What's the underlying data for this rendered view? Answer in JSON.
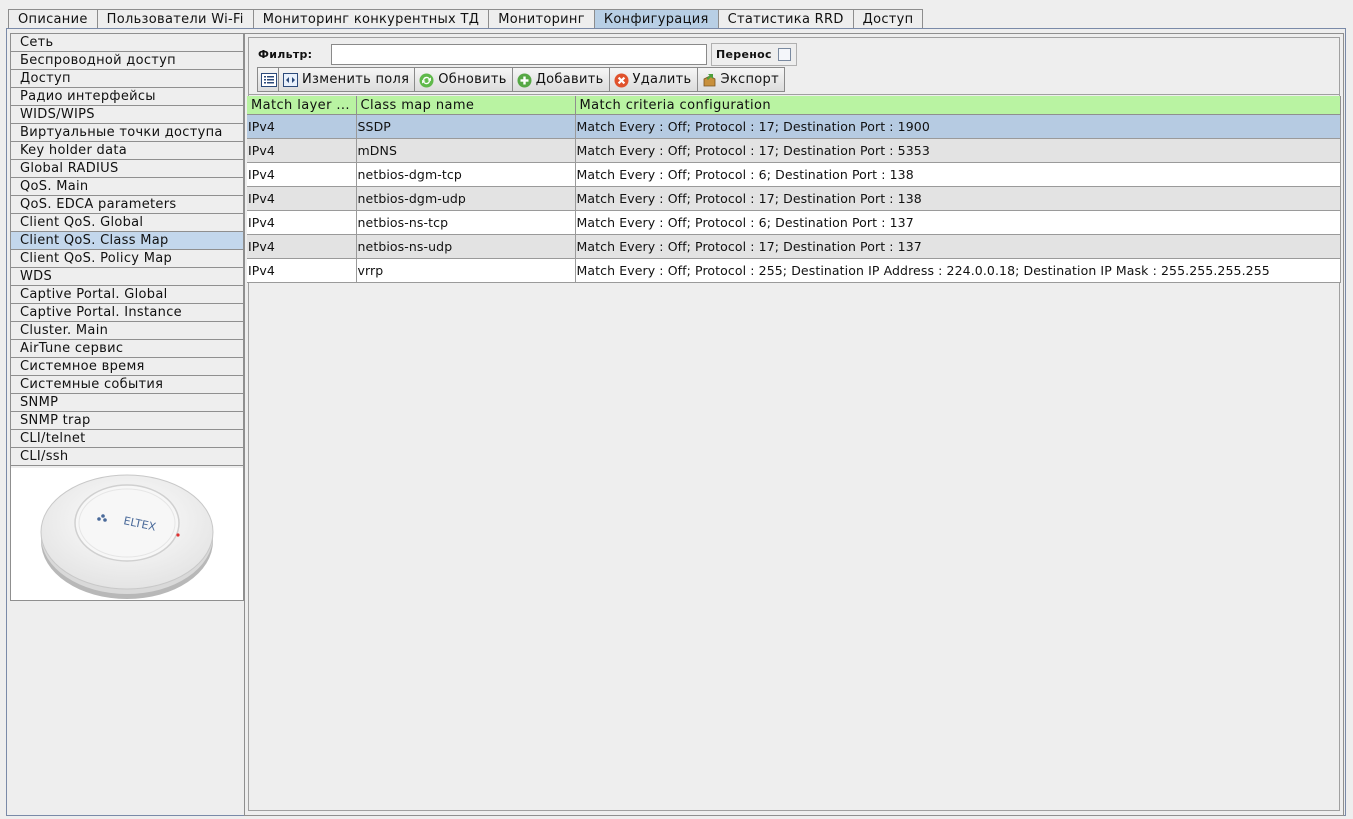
{
  "tabs": [
    {
      "label": "Описание",
      "active": false
    },
    {
      "label": "Пользователи Wi-Fi",
      "active": false
    },
    {
      "label": "Мониторинг конкурентных ТД",
      "active": false
    },
    {
      "label": "Мониторинг",
      "active": false
    },
    {
      "label": "Конфигурация",
      "active": true
    },
    {
      "label": "Статистика RRD",
      "active": false
    },
    {
      "label": "Доступ",
      "active": false
    }
  ],
  "sidebar": {
    "items": [
      "Сеть",
      "Беспроводной доступ",
      "Доступ",
      "Радио интерфейсы",
      "WIDS/WIPS",
      "Виртуальные точки доступа",
      "Key holder data",
      "Global RADIUS",
      "QoS. Main",
      "QoS. EDCA parameters",
      "Client QoS. Global",
      "Client QoS. Class Map",
      "Client QoS. Policy Map",
      "WDS",
      "Captive Portal. Global",
      "Captive Portal. Instance",
      "Cluster. Main",
      "AirTune сервис",
      "Системное время",
      "Системные события",
      "SNMP",
      "SNMP trap",
      "CLI/telnet",
      "CLI/ssh"
    ],
    "active_index": 11,
    "device_logo": "ELTEX"
  },
  "filter": {
    "label": "Фильтр:",
    "value": "",
    "wrap_label": "Перенос",
    "wrap_checked": false
  },
  "toolbar": {
    "list_icon": "list-icon",
    "edit_fields": "Изменить поля",
    "refresh": "Обновить",
    "add": "Добавить",
    "delete": "Удалить",
    "export": "Экспорт"
  },
  "table": {
    "columns": [
      "Match layer ...",
      "Class map name",
      "Match criteria configuration"
    ],
    "rows": [
      [
        "IPv4",
        "SSDP",
        "Match Every : Off; Protocol : 17; Destination Port : 1900"
      ],
      [
        "IPv4",
        "mDNS",
        "Match Every : Off; Protocol : 17; Destination Port : 5353"
      ],
      [
        "IPv4",
        "netbios-dgm-tcp",
        "Match Every : Off; Protocol : 6; Destination Port : 138"
      ],
      [
        "IPv4",
        "netbios-dgm-udp",
        "Match Every : Off; Protocol : 17; Destination Port : 138"
      ],
      [
        "IPv4",
        "netbios-ns-tcp",
        "Match Every : Off; Protocol : 6; Destination Port : 137"
      ],
      [
        "IPv4",
        "netbios-ns-udp",
        "Match Every : Off; Protocol : 17; Destination Port : 137"
      ],
      [
        "IPv4",
        "vrrp",
        "Match Every : Off; Protocol : 255; Destination IP Address : 224.0.0.18; Destination IP Mask : 255.255.255.255"
      ]
    ],
    "selected_row": 0
  },
  "colors": {
    "header_green": "#b9f3a2",
    "selection_blue": "#b6cbe2",
    "tab_active": "#b8cfe5"
  }
}
